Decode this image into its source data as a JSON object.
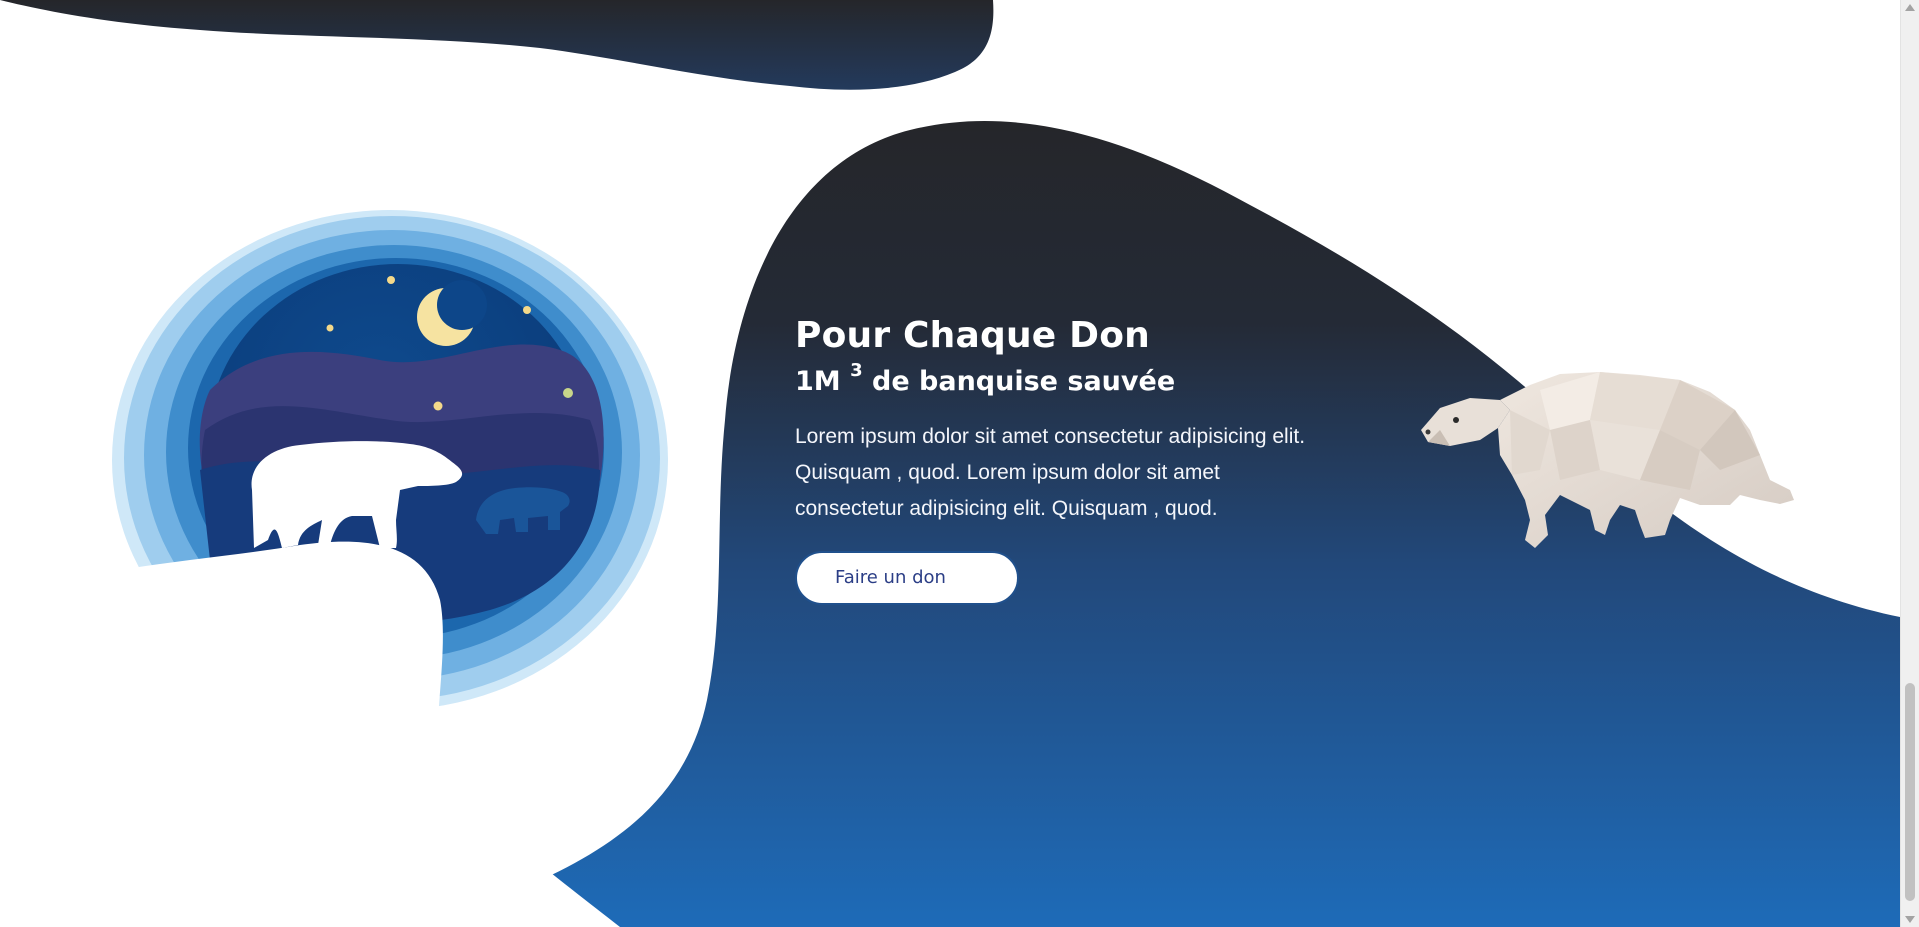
{
  "hero": {
    "title": "Pour Chaque Don",
    "subtitle_main": "1M",
    "subtitle_exponent": "3",
    "subtitle_rest": "de banquise sauvée",
    "text": "Lorem ipsum dolor sit amet consectetur adipisicing elit. Quisquam , quod. Lorem ipsum dolor sit amet consectetur adipisicing elit. Quisquam , quod.",
    "cta_label": "Faire un don"
  },
  "colors": {
    "gradient_top": "#25262a",
    "gradient_bottom": "#1e6bb8",
    "button_border": "#20508c",
    "button_text": "#2b3e86"
  },
  "illustrations": {
    "left": "polar-bear-night-papercut-icon",
    "right": "low-poly-polar-bear-icon"
  }
}
